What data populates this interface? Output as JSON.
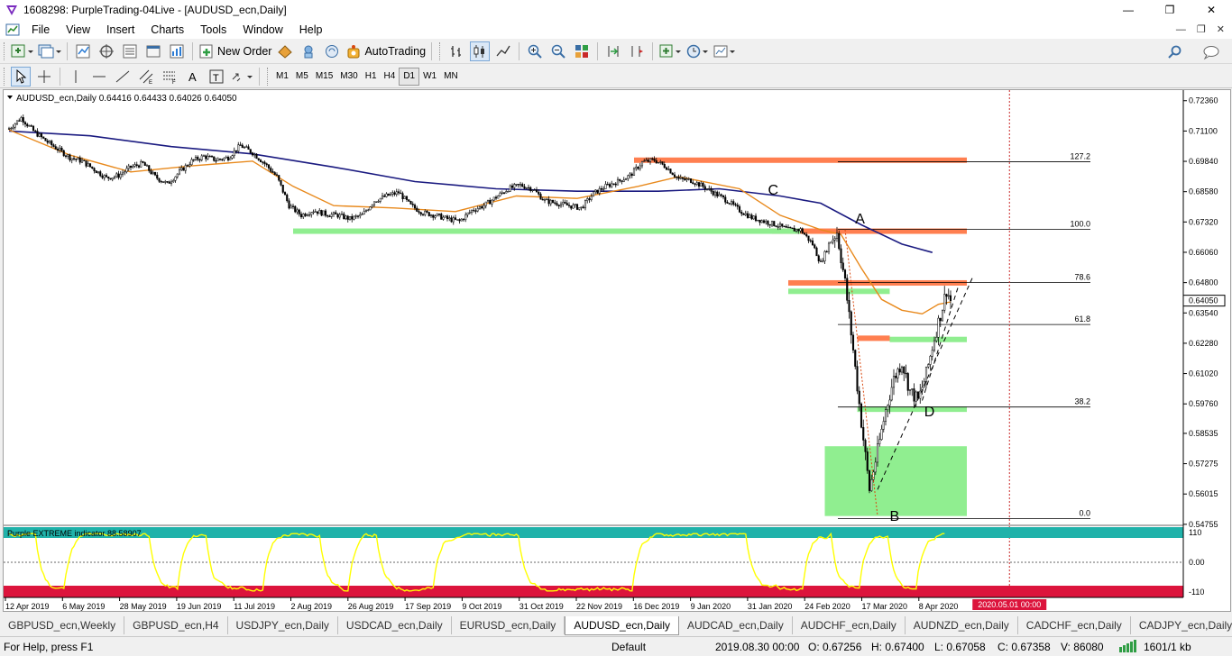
{
  "window": {
    "title": "1608298: PurpleTrading-04Live - [AUDUSD_ecn,Daily]"
  },
  "menu": [
    "File",
    "View",
    "Insert",
    "Charts",
    "Tools",
    "Window",
    "Help"
  ],
  "toolbar": {
    "new_order": "New Order",
    "autotrading": "AutoTrading"
  },
  "timeframes": [
    "M1",
    "M5",
    "M15",
    "M30",
    "H1",
    "H4",
    "D1",
    "W1",
    "MN"
  ],
  "active_timeframe": "D1",
  "chart": {
    "header": "AUDUSD_ecn,Daily  0.64416 0.64433 0.64026 0.64050",
    "current_price": "0.64050",
    "indicator_label": "Purple EXTREME indicator 88.58907",
    "fib_levels": [
      {
        "label": "127.2",
        "price": 0.6982
      },
      {
        "label": "100.0",
        "price": 0.6701
      },
      {
        "label": "78.6",
        "price": 0.648
      },
      {
        "label": "61.8",
        "price": 0.6306
      },
      {
        "label": "38.2",
        "price": 0.5963
      },
      {
        "label": "0.0",
        "price": 0.5499
      }
    ],
    "annotations": [
      "A",
      "B",
      "C",
      "D"
    ],
    "colors": {
      "candle": "#000000",
      "ma_fast": "#e8891c",
      "ma_slow": "#1a1a80",
      "supply_zone": "#ff7f50",
      "demand_zone": "#90ee90",
      "fib_line": "#000000",
      "indicator_line": "#ffff00",
      "indicator_top_band": "#20b2aa",
      "indicator_bottom_band": "#dc143c",
      "price_label_bg": "#dc143c"
    }
  },
  "chart_data": {
    "type": "candlestick",
    "symbol": "AUDUSD_ecn",
    "timeframe": "Daily",
    "ohlc_last": {
      "open": 0.64416,
      "high": 0.64433,
      "low": 0.64026,
      "close": 0.6405
    },
    "price_axis": [
      "0.72360",
      "0.71100",
      "0.69840",
      "0.68580",
      "0.67320",
      "0.66060",
      "0.64800",
      "0.63540",
      "0.62280",
      "0.61020",
      "0.59760",
      "0.58535",
      "0.57275",
      "0.56015",
      "0.54755"
    ],
    "ylim": [
      0.5475,
      0.7265
    ],
    "time_axis": [
      "12 Apr 2019",
      "6 May 2019",
      "28 May 2019",
      "19 Jun 2019",
      "11 Jul 2019",
      "2 Aug 2019",
      "26 Aug 2019",
      "17 Sep 2019",
      "9 Oct 2019",
      "31 Oct 2019",
      "22 Nov 2019",
      "16 Dec 2019",
      "9 Jan 2020",
      "31 Jan 2020",
      "24 Feb 2020",
      "17 Mar 2020",
      "8 Apr 2020"
    ],
    "cursor_time": "2020.05.01 00:00",
    "indicator_axis": [
      "110",
      "0.00",
      "-110"
    ],
    "indicator_ylim": [
      -110,
      110
    ],
    "close_path": [
      [
        0,
        0.712
      ],
      [
        6,
        0.7165
      ],
      [
        12,
        0.711
      ],
      [
        18,
        0.707
      ],
      [
        24,
        0.7035
      ],
      [
        30,
        0.7
      ],
      [
        36,
        0.6985
      ],
      [
        42,
        0.695
      ],
      [
        48,
        0.6915
      ],
      [
        54,
        0.6925
      ],
      [
        60,
        0.696
      ],
      [
        66,
        0.6975
      ],
      [
        72,
        0.692
      ],
      [
        78,
        0.689
      ],
      [
        84,
        0.694
      ],
      [
        90,
        0.6985
      ],
      [
        96,
        0.7005
      ],
      [
        102,
        0.699
      ],
      [
        108,
        0.7
      ],
      [
        114,
        0.705
      ],
      [
        120,
        0.702
      ],
      [
        126,
        0.6975
      ],
      [
        132,
        0.692
      ],
      [
        138,
        0.68
      ],
      [
        144,
        0.676
      ],
      [
        150,
        0.678
      ],
      [
        156,
        0.6765
      ],
      [
        162,
        0.676
      ],
      [
        168,
        0.6745
      ],
      [
        174,
        0.676
      ],
      [
        180,
        0.682
      ],
      [
        186,
        0.684
      ],
      [
        192,
        0.6855
      ],
      [
        198,
        0.68
      ],
      [
        204,
        0.677
      ],
      [
        210,
        0.676
      ],
      [
        216,
        0.6745
      ],
      [
        222,
        0.6735
      ],
      [
        228,
        0.678
      ],
      [
        234,
        0.68
      ],
      [
        240,
        0.6835
      ],
      [
        246,
        0.687
      ],
      [
        252,
        0.6885
      ],
      [
        258,
        0.687
      ],
      [
        264,
        0.682
      ],
      [
        270,
        0.681
      ],
      [
        276,
        0.68
      ],
      [
        282,
        0.679
      ],
      [
        288,
        0.685
      ],
      [
        294,
        0.688
      ],
      [
        300,
        0.69
      ],
      [
        306,
        0.6925
      ],
      [
        312,
        0.698
      ],
      [
        318,
        0.699
      ],
      [
        324,
        0.696
      ],
      [
        330,
        0.691
      ],
      [
        336,
        0.6905
      ],
      [
        342,
        0.688
      ],
      [
        348,
        0.685
      ],
      [
        354,
        0.682
      ],
      [
        360,
        0.678
      ],
      [
        366,
        0.675
      ],
      [
        372,
        0.6735
      ],
      [
        378,
        0.672
      ],
      [
        384,
        0.67
      ],
      [
        390,
        0.67
      ],
      [
        396,
        0.664
      ],
      [
        400,
        0.656
      ],
      [
        404,
        0.664
      ],
      [
        408,
        0.669
      ],
      [
        412,
        0.648
      ],
      [
        416,
        0.62
      ],
      [
        420,
        0.59
      ],
      [
        424,
        0.562
      ],
      [
        428,
        0.578
      ],
      [
        432,
        0.595
      ],
      [
        436,
        0.608
      ],
      [
        440,
        0.615
      ],
      [
        444,
        0.603
      ],
      [
        448,
        0.599
      ],
      [
        452,
        0.61
      ],
      [
        456,
        0.625
      ],
      [
        460,
        0.638
      ],
      [
        462,
        0.645
      ],
      [
        464,
        0.6405
      ]
    ],
    "bars_total": 464,
    "sma_fast": [
      [
        0,
        0.7115
      ],
      [
        30,
        0.701
      ],
      [
        60,
        0.694
      ],
      [
        90,
        0.6965
      ],
      [
        120,
        0.6985
      ],
      [
        140,
        0.688
      ],
      [
        160,
        0.68
      ],
      [
        190,
        0.679
      ],
      [
        220,
        0.6775
      ],
      [
        250,
        0.684
      ],
      [
        280,
        0.683
      ],
      [
        310,
        0.688
      ],
      [
        330,
        0.692
      ],
      [
        360,
        0.687
      ],
      [
        380,
        0.676
      ],
      [
        400,
        0.67
      ],
      [
        410,
        0.668
      ],
      [
        420,
        0.654
      ],
      [
        430,
        0.641
      ],
      [
        440,
        0.6365
      ],
      [
        450,
        0.635
      ],
      [
        458,
        0.639
      ],
      [
        464,
        0.64
      ]
    ],
    "sma_slow": [
      [
        0,
        0.711
      ],
      [
        40,
        0.709
      ],
      [
        80,
        0.7045
      ],
      [
        120,
        0.7015
      ],
      [
        160,
        0.696
      ],
      [
        200,
        0.69
      ],
      [
        240,
        0.687
      ],
      [
        280,
        0.686
      ],
      [
        320,
        0.686
      ],
      [
        350,
        0.687
      ],
      [
        380,
        0.684
      ],
      [
        400,
        0.681
      ],
      [
        420,
        0.672
      ],
      [
        440,
        0.664
      ],
      [
        455,
        0.6605
      ]
    ],
    "zones": [
      {
        "kind": "supply",
        "from_bar": 308,
        "to_bar": 472,
        "low": 0.6985,
        "high": 0.7
      },
      {
        "kind": "supply",
        "from_bar": 376,
        "to_bar": 472,
        "low": 0.669,
        "high": 0.6705
      },
      {
        "kind": "supply",
        "from_bar": 384,
        "to_bar": 472,
        "low": 0.6475,
        "high": 0.649
      },
      {
        "kind": "supply",
        "from_bar": 418,
        "to_bar": 434,
        "low": 0.6245,
        "high": 0.626
      },
      {
        "kind": "demand",
        "from_bar": 140,
        "to_bar": 390,
        "low": 0.669,
        "high": 0.6705
      },
      {
        "kind": "demand",
        "from_bar": 384,
        "to_bar": 434,
        "low": 0.644,
        "high": 0.6455
      },
      {
        "kind": "demand",
        "from_bar": 434,
        "to_bar": 472,
        "low": 0.624,
        "high": 0.6255
      },
      {
        "kind": "demand",
        "from_bar": 418,
        "to_bar": 472,
        "low": 0.595,
        "high": 0.5965
      },
      {
        "kind": "demand",
        "from_bar": 402,
        "to_bar": 472,
        "low": 0.551,
        "high": 0.58
      }
    ]
  },
  "tabs": [
    "GBPUSD_ecn,Weekly",
    "GBPUSD_ecn,H4",
    "USDJPY_ecn,Daily",
    "USDCAD_ecn,Daily",
    "EURUSD_ecn,Daily",
    "AUDUSD_ecn,Daily",
    "AUDCAD_ecn,Daily",
    "AUDCHF_ecn,Daily",
    "AUDNZD_ecn,Daily",
    "CADCHF_ecn,Daily",
    "CADJPY_ecn,Daily"
  ],
  "active_tab": "AUDUSD_ecn,Daily",
  "status": {
    "help": "For Help, press F1",
    "profile": "Default",
    "datetime": "2019.08.30 00:00",
    "open": "O: 0.67256",
    "high": "H: 0.67400",
    "low": "L: 0.67058",
    "close": "C: 0.67358",
    "volume": "V: 86080",
    "traffic": "1601/1 kb"
  }
}
